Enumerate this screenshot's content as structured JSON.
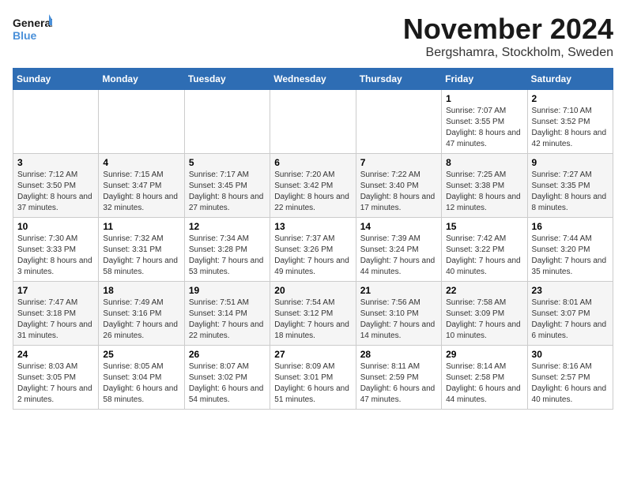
{
  "logo": {
    "line1": "General",
    "line2": "Blue"
  },
  "title": "November 2024",
  "location": "Bergshamra, Stockholm, Sweden",
  "weekdays": [
    "Sunday",
    "Monday",
    "Tuesday",
    "Wednesday",
    "Thursday",
    "Friday",
    "Saturday"
  ],
  "weeks": [
    [
      {
        "day": "",
        "info": ""
      },
      {
        "day": "",
        "info": ""
      },
      {
        "day": "",
        "info": ""
      },
      {
        "day": "",
        "info": ""
      },
      {
        "day": "",
        "info": ""
      },
      {
        "day": "1",
        "info": "Sunrise: 7:07 AM\nSunset: 3:55 PM\nDaylight: 8 hours and 47 minutes."
      },
      {
        "day": "2",
        "info": "Sunrise: 7:10 AM\nSunset: 3:52 PM\nDaylight: 8 hours and 42 minutes."
      }
    ],
    [
      {
        "day": "3",
        "info": "Sunrise: 7:12 AM\nSunset: 3:50 PM\nDaylight: 8 hours and 37 minutes."
      },
      {
        "day": "4",
        "info": "Sunrise: 7:15 AM\nSunset: 3:47 PM\nDaylight: 8 hours and 32 minutes."
      },
      {
        "day": "5",
        "info": "Sunrise: 7:17 AM\nSunset: 3:45 PM\nDaylight: 8 hours and 27 minutes."
      },
      {
        "day": "6",
        "info": "Sunrise: 7:20 AM\nSunset: 3:42 PM\nDaylight: 8 hours and 22 minutes."
      },
      {
        "day": "7",
        "info": "Sunrise: 7:22 AM\nSunset: 3:40 PM\nDaylight: 8 hours and 17 minutes."
      },
      {
        "day": "8",
        "info": "Sunrise: 7:25 AM\nSunset: 3:38 PM\nDaylight: 8 hours and 12 minutes."
      },
      {
        "day": "9",
        "info": "Sunrise: 7:27 AM\nSunset: 3:35 PM\nDaylight: 8 hours and 8 minutes."
      }
    ],
    [
      {
        "day": "10",
        "info": "Sunrise: 7:30 AM\nSunset: 3:33 PM\nDaylight: 8 hours and 3 minutes."
      },
      {
        "day": "11",
        "info": "Sunrise: 7:32 AM\nSunset: 3:31 PM\nDaylight: 7 hours and 58 minutes."
      },
      {
        "day": "12",
        "info": "Sunrise: 7:34 AM\nSunset: 3:28 PM\nDaylight: 7 hours and 53 minutes."
      },
      {
        "day": "13",
        "info": "Sunrise: 7:37 AM\nSunset: 3:26 PM\nDaylight: 7 hours and 49 minutes."
      },
      {
        "day": "14",
        "info": "Sunrise: 7:39 AM\nSunset: 3:24 PM\nDaylight: 7 hours and 44 minutes."
      },
      {
        "day": "15",
        "info": "Sunrise: 7:42 AM\nSunset: 3:22 PM\nDaylight: 7 hours and 40 minutes."
      },
      {
        "day": "16",
        "info": "Sunrise: 7:44 AM\nSunset: 3:20 PM\nDaylight: 7 hours and 35 minutes."
      }
    ],
    [
      {
        "day": "17",
        "info": "Sunrise: 7:47 AM\nSunset: 3:18 PM\nDaylight: 7 hours and 31 minutes."
      },
      {
        "day": "18",
        "info": "Sunrise: 7:49 AM\nSunset: 3:16 PM\nDaylight: 7 hours and 26 minutes."
      },
      {
        "day": "19",
        "info": "Sunrise: 7:51 AM\nSunset: 3:14 PM\nDaylight: 7 hours and 22 minutes."
      },
      {
        "day": "20",
        "info": "Sunrise: 7:54 AM\nSunset: 3:12 PM\nDaylight: 7 hours and 18 minutes."
      },
      {
        "day": "21",
        "info": "Sunrise: 7:56 AM\nSunset: 3:10 PM\nDaylight: 7 hours and 14 minutes."
      },
      {
        "day": "22",
        "info": "Sunrise: 7:58 AM\nSunset: 3:09 PM\nDaylight: 7 hours and 10 minutes."
      },
      {
        "day": "23",
        "info": "Sunrise: 8:01 AM\nSunset: 3:07 PM\nDaylight: 7 hours and 6 minutes."
      }
    ],
    [
      {
        "day": "24",
        "info": "Sunrise: 8:03 AM\nSunset: 3:05 PM\nDaylight: 7 hours and 2 minutes."
      },
      {
        "day": "25",
        "info": "Sunrise: 8:05 AM\nSunset: 3:04 PM\nDaylight: 6 hours and 58 minutes."
      },
      {
        "day": "26",
        "info": "Sunrise: 8:07 AM\nSunset: 3:02 PM\nDaylight: 6 hours and 54 minutes."
      },
      {
        "day": "27",
        "info": "Sunrise: 8:09 AM\nSunset: 3:01 PM\nDaylight: 6 hours and 51 minutes."
      },
      {
        "day": "28",
        "info": "Sunrise: 8:11 AM\nSunset: 2:59 PM\nDaylight: 6 hours and 47 minutes."
      },
      {
        "day": "29",
        "info": "Sunrise: 8:14 AM\nSunset: 2:58 PM\nDaylight: 6 hours and 44 minutes."
      },
      {
        "day": "30",
        "info": "Sunrise: 8:16 AM\nSunset: 2:57 PM\nDaylight: 6 hours and 40 minutes."
      }
    ]
  ]
}
